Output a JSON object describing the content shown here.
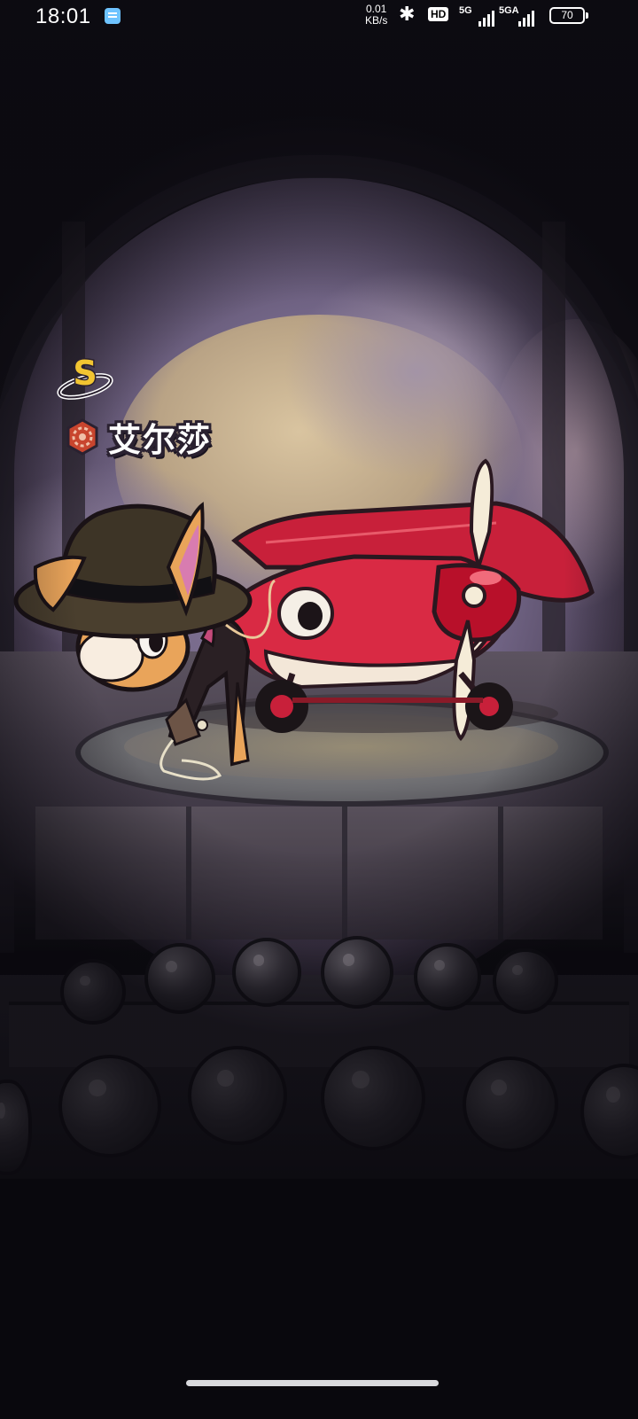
{
  "status_bar": {
    "time": "18:01",
    "net_speed_value": "0.01",
    "net_speed_unit": "KB/s",
    "hd_label": "HD",
    "signal_1_label": "5G",
    "signal_2_label": "5GA",
    "battery": "70",
    "icons": [
      "notes-app-icon",
      "bluetooth-icon",
      "hd-voice-icon",
      "signal-icon",
      "battery-icon"
    ]
  },
  "character": {
    "rank": "S",
    "name": "艾尔莎",
    "class_icon": "gear-emblem-icon"
  },
  "colors": {
    "rank_gold": "#f2c531",
    "emblem_red": "#c8452e",
    "plane_red": "#d8283f",
    "name_text": "#ffffff"
  }
}
